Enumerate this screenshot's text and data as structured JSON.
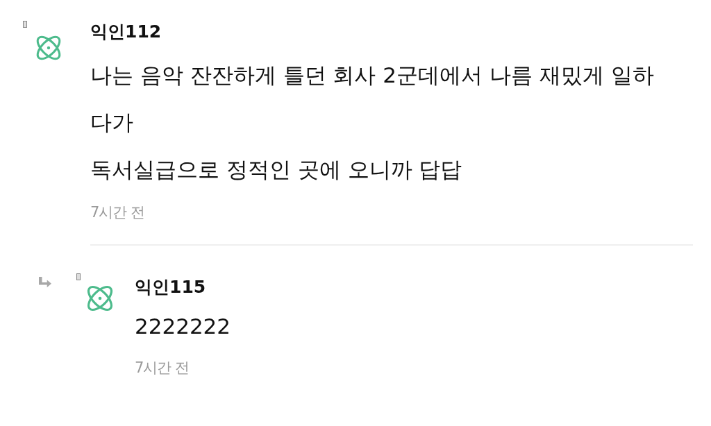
{
  "comments": [
    {
      "author": "익인112",
      "body": "나는 음악 잔잔하게 틀던 회사 2군데에서 나름 재밌게 일하\n다가\n독서실급으로 정적인 곳에 오니까 답답",
      "time": "7시간 전",
      "replies": [
        {
          "author": "익인115",
          "body": "2222222",
          "time": "7시간 전"
        }
      ]
    }
  ]
}
